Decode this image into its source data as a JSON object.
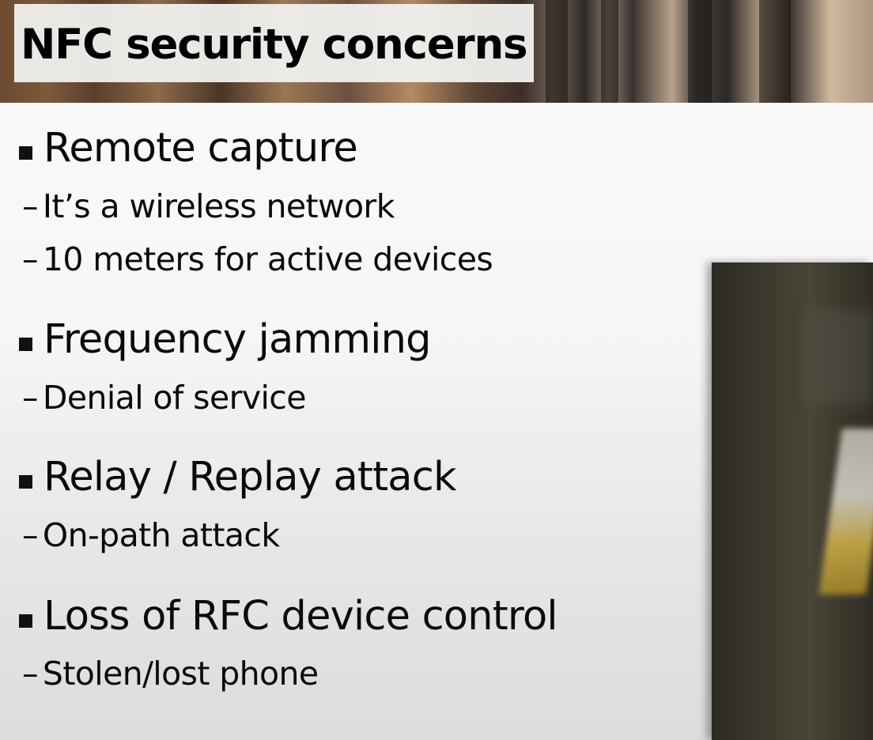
{
  "slide": {
    "title": "NFC security concerns",
    "bullets": [
      {
        "text": "Remote capture",
        "subs": [
          "It’s a wireless network",
          "10 meters for active devices"
        ]
      },
      {
        "text": "Frequency jamming",
        "subs": [
          "Denial of service"
        ]
      },
      {
        "text": "Relay / Replay attack",
        "subs": [
          "On-path attack"
        ]
      },
      {
        "text": "Loss of RFC device control",
        "subs": [
          "Stolen/lost phone"
        ]
      }
    ],
    "sub_dash": "–"
  },
  "colors": {
    "text": "#0a0a0a",
    "title_box": "#f0f0ee",
    "bullet_marker": "#111111"
  },
  "icons": {
    "bullet": "square-bullet-icon"
  }
}
